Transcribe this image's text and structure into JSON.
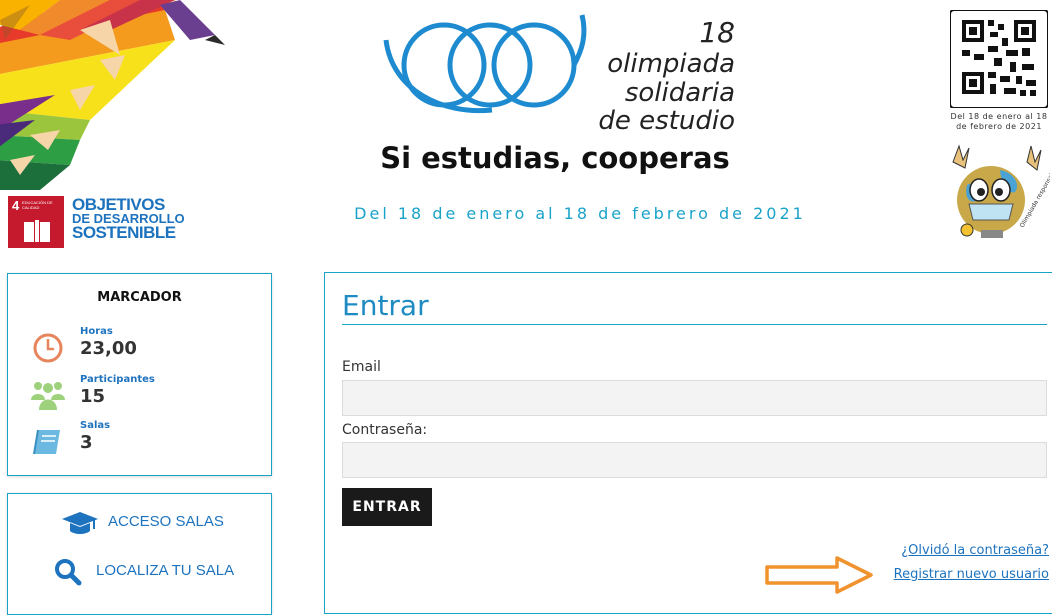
{
  "header": {
    "sdg": {
      "number": "4",
      "goal_small": "EDUCACIÓN DE CALIDAD",
      "line1": "OBJETIVOS",
      "line2": "DE DESARROLLO",
      "line3": "SOSTENIBLE"
    },
    "event": {
      "number": "18",
      "line1_rest": "olimpiada",
      "line2": "solidaria",
      "line3": "de estudio"
    },
    "tagline": "Si estudias, cooperas",
    "dates": "Del 18 de enero al 18 de febrero de 2021",
    "qr_caption_line1": "Del 18 de enero al 18",
    "qr_caption_line2": "de febrero de 2021",
    "mascot_caption": "Olimpiada responsable"
  },
  "marcador": {
    "title": "MARCADOR",
    "stats": [
      {
        "label": "Horas",
        "value": "23,00",
        "icon": "clock-icon"
      },
      {
        "label": "Participantes",
        "value": "15",
        "icon": "people-icon"
      },
      {
        "label": "Salas",
        "value": "3",
        "icon": "book-icon"
      }
    ]
  },
  "access": {
    "salas_label": "ACCESO SALAS",
    "localiza_label": "LOCALIZA TU SALA"
  },
  "login": {
    "title": "Entrar",
    "email_label": "Email",
    "email_value": "",
    "password_label": "Contraseña:",
    "password_value": "",
    "submit_label": "ENTRAR",
    "forgot_label": "¿Olvidó la contraseña?",
    "register_label": "Registrar nuevo usuario"
  },
  "colors": {
    "accent": "#1aa3c8",
    "link": "#1e73be",
    "button": "#1a1a1a",
    "arrow": "#f0922e",
    "sdg_red": "#c5192d"
  }
}
